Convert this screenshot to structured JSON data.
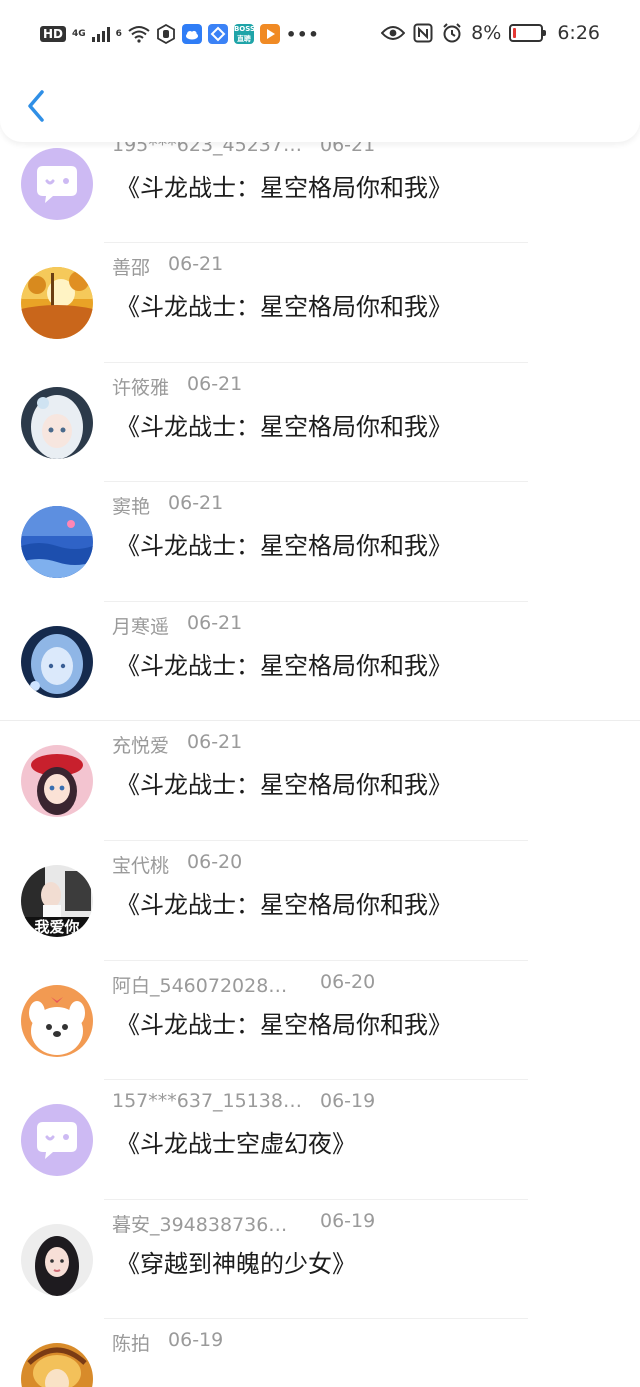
{
  "status_bar": {
    "hd": "HD",
    "network": "4G",
    "wifi_badge": "6",
    "boss_label": "BOSS\n直聘",
    "more": "•••",
    "battery_percent": "8%",
    "time": "6:26"
  },
  "header": {
    "back_icon": "chevron-left-icon",
    "accent": "#2f8fe6"
  },
  "comments": [
    {
      "name": "195***623_45237…",
      "date": "06-21",
      "text": "《斗龙战士：星空格局你和我》",
      "avatar": "default-chat"
    },
    {
      "name": "善邵",
      "date": "06-21",
      "text": "《斗龙战士：星空格局你和我》",
      "avatar": "autumn"
    },
    {
      "name": "许筱雅",
      "date": "06-21",
      "text": "《斗龙战士：星空格局你和我》",
      "avatar": "anime-white"
    },
    {
      "name": "窦艳",
      "date": "06-21",
      "text": "《斗龙战士：星空格局你和我》",
      "avatar": "blue-sea"
    },
    {
      "name": "月寒遥",
      "date": "06-21",
      "text": "《斗龙战士：星空格局你和我》",
      "avatar": "ice-girl"
    },
    {
      "name": "充悦爱",
      "date": "06-21",
      "text": "《斗龙战士：星空格局你和我》",
      "avatar": "red-hat-girl"
    },
    {
      "name": "宝代桃",
      "date": "06-20",
      "text": "《斗龙战士：星空格局你和我》",
      "avatar": "photo-girl",
      "avatar_text": "我爱你"
    },
    {
      "name": "阿白_546072028…",
      "date": "06-20",
      "text": "《斗龙战士：星空格局你和我》",
      "avatar": "puppy"
    },
    {
      "name": "157***637_15138…",
      "date": "06-19",
      "text": "《斗龙战士空虚幻夜》",
      "avatar": "default-chat"
    },
    {
      "name": "暮安_394838736…",
      "date": "06-19",
      "text": "《穿越到神魄的少女》",
      "avatar": "dark-hair-girl"
    },
    {
      "name": "陈拍",
      "date": "06-19",
      "text": "",
      "avatar": "golden"
    }
  ]
}
